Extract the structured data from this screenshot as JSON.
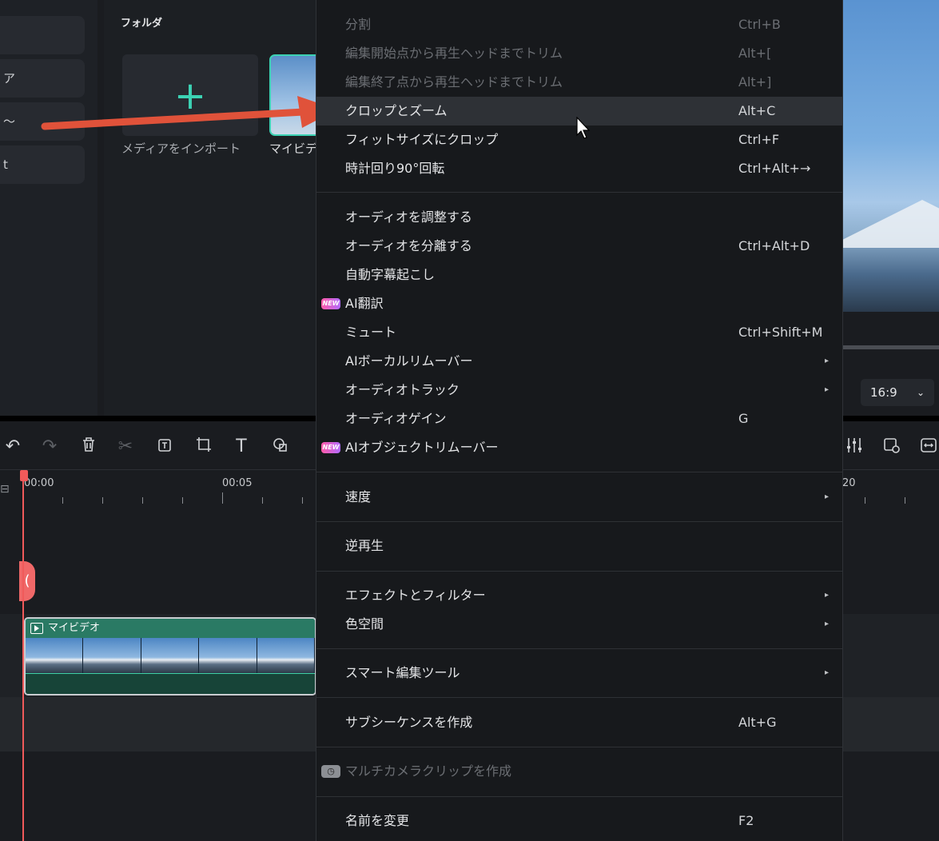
{
  "sidebar": {
    "items": [
      {
        "label": ""
      },
      {
        "label": "ア"
      },
      {
        "label": "〜"
      },
      {
        "label": "t"
      }
    ]
  },
  "media": {
    "folder_label": "フォルダ",
    "import_label": "メディアをインポート",
    "video_label": "マイビデ"
  },
  "preview": {
    "ratio": "16:9"
  },
  "timeline": {
    "timecodes": [
      "00:00",
      "00:05",
      "20"
    ],
    "clip_name": "マイビデオ"
  },
  "toolbar": {
    "icons": [
      "undo-icon",
      "redo-icon",
      "delete-icon",
      "cut-icon",
      "add-text-icon",
      "crop-icon",
      "text-icon",
      "shape-icon",
      "audio-mixer-icon",
      "preview-swap-icon",
      "fit-icon"
    ]
  },
  "menu": {
    "items": [
      {
        "label": "分割",
        "shortcut": "Ctrl+B",
        "disabled": true
      },
      {
        "label": "編集開始点から再生ヘッドまでトリム",
        "shortcut": "Alt+[",
        "disabled": true
      },
      {
        "label": "編集終了点から再生ヘッドまでトリム",
        "shortcut": "Alt+]",
        "disabled": true
      },
      {
        "label": "クロップとズーム",
        "shortcut": "Alt+C",
        "highlighted": true
      },
      {
        "label": "フィットサイズにクロップ",
        "shortcut": "Ctrl+F"
      },
      {
        "label": "時計回り90°回転",
        "shortcut": "Ctrl+Alt+→"
      },
      {
        "label": "オーディオを調整する",
        "shortcut": ""
      },
      {
        "label": "オーディオを分離する",
        "shortcut": "Ctrl+Alt+D"
      },
      {
        "label": "自動字幕起こし",
        "shortcut": ""
      },
      {
        "label": "AI翻訳",
        "shortcut": "",
        "badge": "NEW"
      },
      {
        "label": "ミュート",
        "shortcut": "Ctrl+Shift+M"
      },
      {
        "label": "AIボーカルリムーバー",
        "shortcut": "",
        "submenu": true
      },
      {
        "label": "オーディオトラック",
        "shortcut": "",
        "submenu": true
      },
      {
        "label": "オーディオゲイン",
        "shortcut": "G"
      },
      {
        "label": "AIオブジェクトリムーバー",
        "shortcut": "",
        "badge": "NEW"
      },
      {
        "label": "速度",
        "shortcut": "",
        "submenu": true
      },
      {
        "label": "逆再生",
        "shortcut": ""
      },
      {
        "label": "エフェクトとフィルター",
        "shortcut": "",
        "submenu": true
      },
      {
        "label": "色空間",
        "shortcut": "",
        "submenu": true
      },
      {
        "label": "スマート編集ツール",
        "shortcut": "",
        "submenu": true
      },
      {
        "label": "サブシーケンスを作成",
        "shortcut": "Alt+G"
      },
      {
        "label": "マルチカメラクリップを作成",
        "shortcut": "",
        "disabled": true
      },
      {
        "label": "名前を変更",
        "shortcut": "F2"
      }
    ],
    "badge_text": "NEW",
    "submenu_glyph": "▸"
  },
  "colors": {
    "accent": "#3cd2b4",
    "playhead": "#f05a5a",
    "arrow": "#e0523a"
  }
}
